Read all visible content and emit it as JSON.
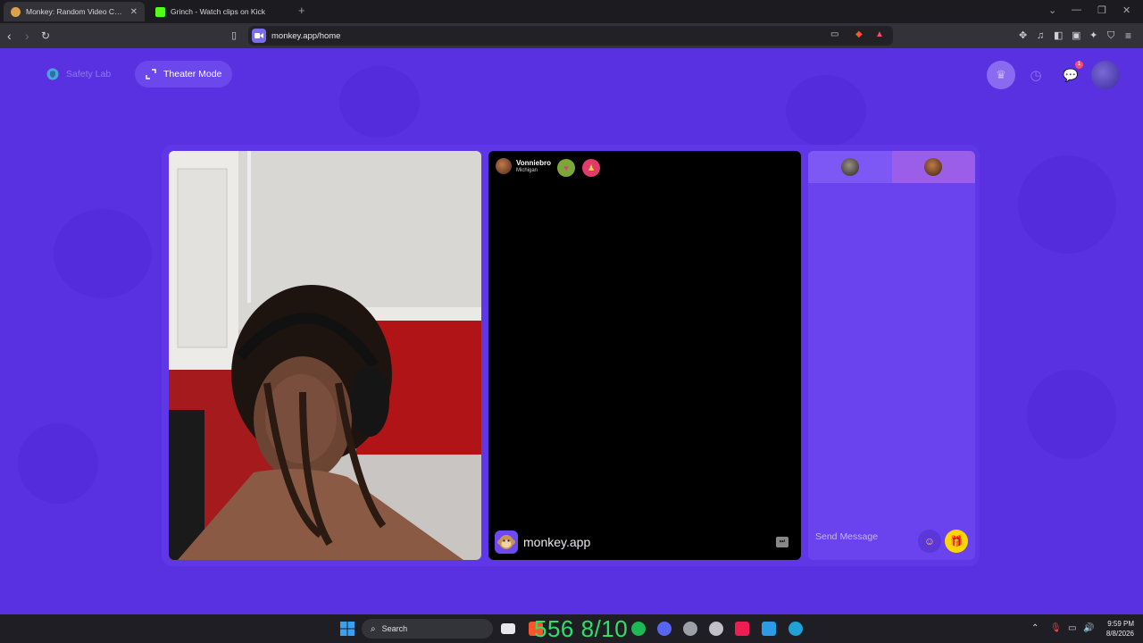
{
  "browser": {
    "tabs": [
      {
        "title": "Monkey: Random Video Chat",
        "active": true,
        "favicon_color": "#d9a34a"
      },
      {
        "title": "Grinch - Watch clips on Kick",
        "active": false,
        "favicon_color": "#53fc18"
      }
    ],
    "url": "monkey.app/home",
    "colors": {
      "accent": "#7c6cf0"
    }
  },
  "page": {
    "safety_lab_label": "Safety Lab",
    "theater_mode_label": "Theater Mode",
    "notification_count": "1",
    "colors": {
      "background": "#5a31e0",
      "panel": "#6a42ee"
    }
  },
  "partner": {
    "name": "Vonniebro",
    "location": "Michigan"
  },
  "brand": {
    "name": "monkey.app"
  },
  "chat": {
    "placeholder": "Send Message"
  },
  "taskbar": {
    "search_label": "Search",
    "overlay_text": "556 8/10",
    "time": "9:59 PM",
    "date": "8/8/2026"
  }
}
